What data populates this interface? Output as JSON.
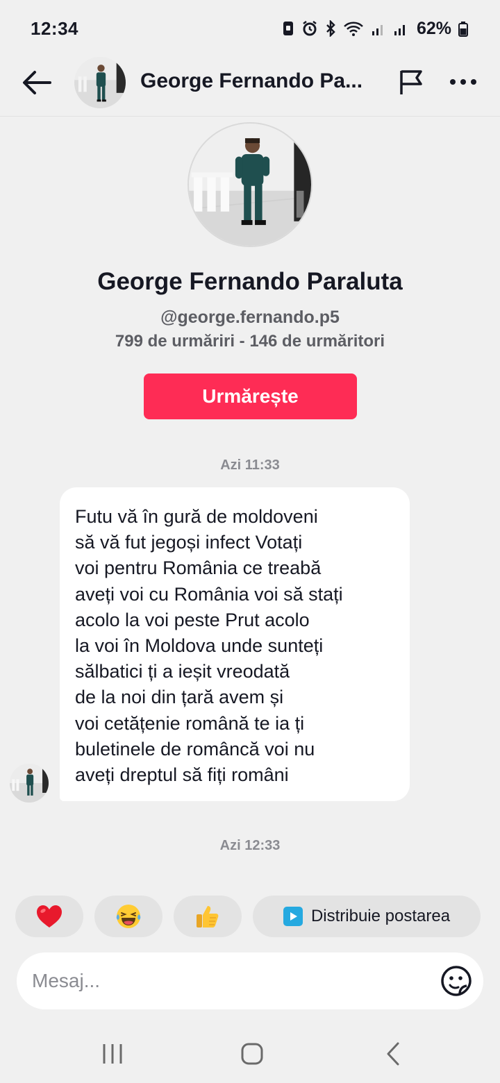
{
  "status_bar": {
    "time": "12:34",
    "battery_percent": "62%",
    "icons": [
      "notification-icon",
      "alarm-icon",
      "bluetooth-icon",
      "wifi-icon",
      "signal-icon",
      "signal-icon",
      "battery-icon"
    ]
  },
  "header": {
    "name": "George Fernando Pa...",
    "icons": [
      "back-arrow-icon",
      "flag-icon",
      "more-icon"
    ]
  },
  "profile": {
    "name": "George Fernando Paraluta",
    "handle": "@george.fernando.p5",
    "stats": "799 de urmăriri - 146 de urmăritori",
    "follow_label": "Urmărește"
  },
  "conversation": {
    "timestamp_1": "Azi 11:33",
    "message": "Futu vă în gură de moldoveni\nsă vă fut jegoși infect Votați\nvoi pentru România ce treabă\naveți voi cu România voi să stați\nacolo la voi peste Prut acolo\nla voi în Moldova unde sunteți\nsălbatici ți a ieșit vreodată\nde la noi din țară avem și\nvoi cetățenie română te ia ți\nbuletinele de româncă voi nu\naveți dreptul să fiți români",
    "timestamp_2": "Azi 12:33"
  },
  "quick_replies": {
    "emoji_1": "❤️",
    "emoji_2": "😂",
    "emoji_3": "👍",
    "share_label": "Distribuie postarea"
  },
  "composer": {
    "placeholder": "Mesaj..."
  },
  "colors": {
    "accent": "#fe2c55",
    "background": "#f0f0f0",
    "bubble": "#ffffff",
    "share_icon": "#25a9e0"
  }
}
